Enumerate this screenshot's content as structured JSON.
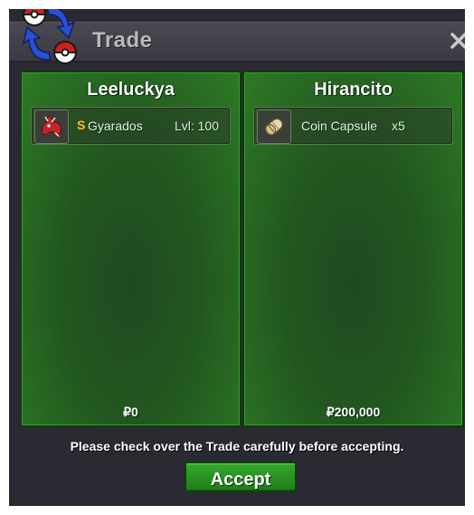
{
  "window": {
    "title": "Trade",
    "close_symbol": "✕"
  },
  "trade": {
    "left": {
      "player_name": "Leeluckya",
      "items": [
        {
          "icon": "gyarados-pokemon-icon",
          "badge": "S",
          "name": "Gyarados",
          "level": "Lvl: 100"
        }
      ],
      "money": "₽0"
    },
    "right": {
      "player_name": "Hirancito",
      "items": [
        {
          "icon": "coin-capsule-icon",
          "name": "Coin Capsule",
          "quantity": "x5"
        }
      ],
      "money": "₽200,000"
    }
  },
  "footer": {
    "notice": "Please check over the Trade carefully before accepting.",
    "accept_label": "Accept"
  },
  "colors": {
    "panel_green": "#22571f",
    "accept_green": "#2a9a22",
    "shiny_gold": "#f5c518",
    "window_bg": "#2b2a33"
  }
}
